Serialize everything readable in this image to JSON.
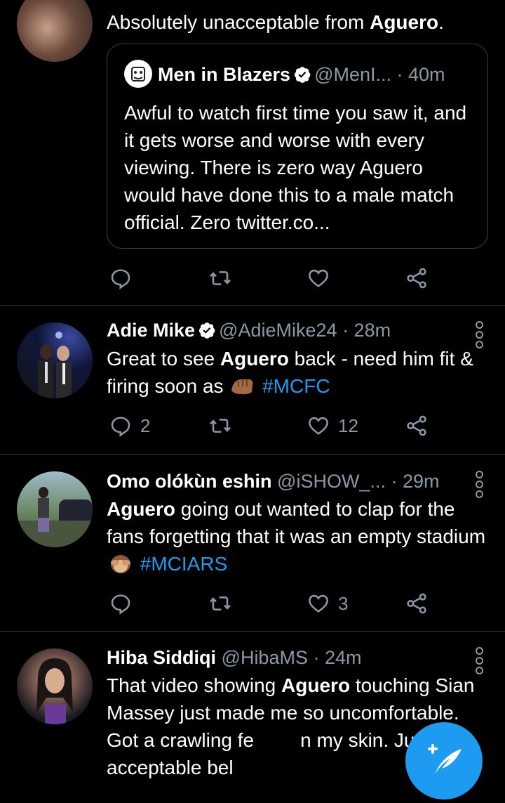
{
  "colors": {
    "background": "#000000",
    "accent": "#1d9bf0",
    "muted": "#8b98a5",
    "divider": "#2f3336"
  },
  "tweets": [
    {
      "body_parts": [
        "Absolutely unacceptable from ",
        "Aguero",
        "."
      ],
      "quote": {
        "name": "Men in Blazers",
        "handle": "@MenI...",
        "time": "· 40m",
        "text": "Awful to watch first time you saw it, and it gets worse and worse with every viewing.  There is zero way Aguero would have done this to a male match official. Zero twitter.co..."
      }
    },
    {
      "name": "Adie Mike",
      "handle": "@AdieMike24",
      "time": "· 28m",
      "body_parts": [
        "Great to see ",
        "Aguero",
        " back - need him fit & firing soon as ",
        "#MCFC"
      ],
      "reply_count": "2",
      "like_count": "12"
    },
    {
      "name": "Omo olókùn eshin",
      "handle": "@iSHOW_...",
      "time": "· 29m",
      "body_parts": [
        "Aguero",
        " going out wanted to clap for the fans forgetting that it was an empty stadium ",
        "#MCIARS"
      ],
      "reply_count": "",
      "like_count": "3"
    },
    {
      "name": "Hiba Siddiqi",
      "handle": "@HibaMS",
      "time": "· 24m",
      "body_parts": [
        "That video showing ",
        "Aguero",
        " touching Sian Massey just made me so uncomfortable. Got a crawling fe",
        "n my skin. Just not acceptable bel"
      ]
    }
  ],
  "icons": [
    "reply-icon",
    "retweet-icon",
    "like-icon",
    "share-icon",
    "verified-icon",
    "more-icon",
    "compose-icon"
  ]
}
